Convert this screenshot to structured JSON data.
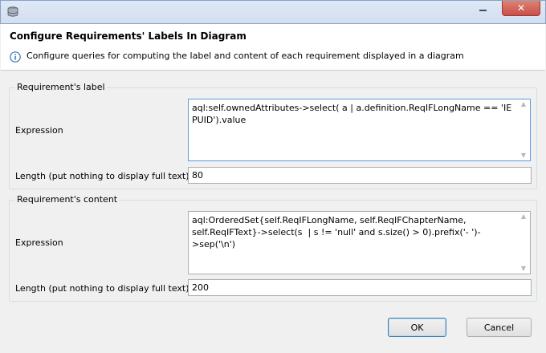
{
  "window": {
    "title": "",
    "close_glyph": "✕"
  },
  "header": {
    "title": "Configure Requirements' Labels In Diagram",
    "message": "Configure queries for computing the label and content of each requirement displayed in a diagram",
    "info_icon": "info-icon"
  },
  "label_group": {
    "legend": "Requirement's label",
    "expression_label": "Expression",
    "expression_value": "aql:self.ownedAttributes->select( a | a.definition.ReqIFLongName == 'IE PUID').value",
    "length_label": "Length (put nothing to display full text):",
    "length_value": "80"
  },
  "content_group": {
    "legend": "Requirement's content",
    "expression_label": "Expression",
    "expression_value": "aql:OrderedSet{self.ReqIFLongName, self.ReqIFChapterName, self.ReqIFText}->select(s  | s != 'null' and s.size() > 0).prefix('- ')->sep('\\n')",
    "length_label": "Length (put nothing to display full text):",
    "length_value": "200"
  },
  "buttons": {
    "ok": "OK",
    "cancel": "Cancel"
  },
  "colors": {
    "focus_border": "#569de5",
    "close_button": "#c75050"
  }
}
